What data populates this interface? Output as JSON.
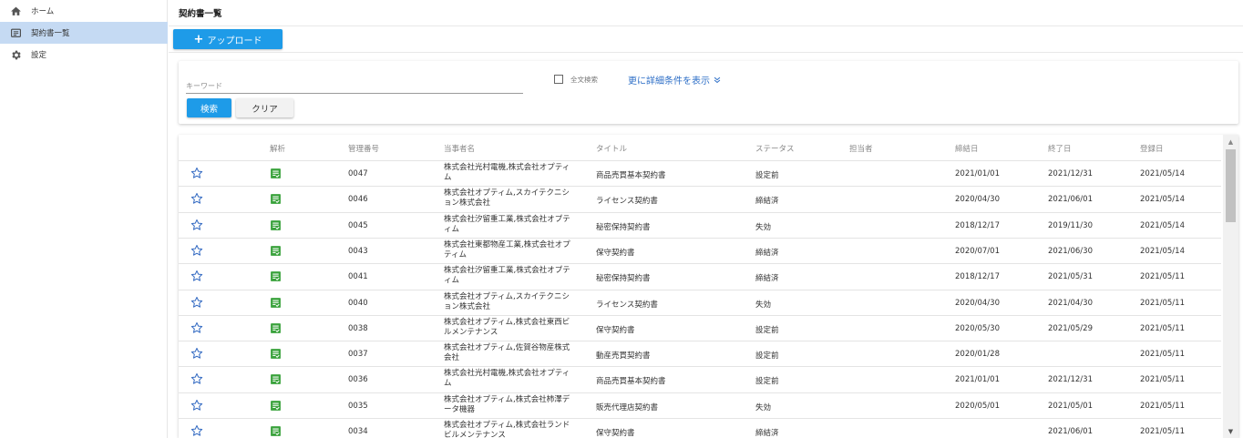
{
  "sidebar": {
    "items": [
      {
        "label": "ホーム",
        "icon": "home-icon"
      },
      {
        "label": "契約書一覧",
        "icon": "list-icon"
      },
      {
        "label": "設定",
        "icon": "gear-icon"
      }
    ]
  },
  "header": {
    "title": "契約書一覧"
  },
  "toolbar": {
    "upload_label": "アップロード",
    "upload_plus": "+"
  },
  "search": {
    "keyword_placeholder": "キーワード",
    "keyword_value": "",
    "fulltext_label": "全文検索",
    "more_conditions_label": "更に詳細条件を表示",
    "search_button": "検索",
    "clear_button": "クリア"
  },
  "table": {
    "columns": [
      "解析",
      "管理番号",
      "当事者名",
      "タイトル",
      "ステータス",
      "担当者",
      "締結日",
      "終了日",
      "登録日"
    ],
    "rows": [
      {
        "no": "0047",
        "party": "株式会社光村電機,株式会社オプティム",
        "title": "商品売買基本契約書",
        "status": "設定前",
        "owner": "",
        "signed": "2021/01/01",
        "end": "2021/12/31",
        "registered": "2021/05/14"
      },
      {
        "no": "0046",
        "party": "株式会社オプティム,スカイテクニション株式会社",
        "title": "ライセンス契約書",
        "status": "締結済",
        "owner": "",
        "signed": "2020/04/30",
        "end": "2021/06/01",
        "registered": "2021/05/14"
      },
      {
        "no": "0045",
        "party": "株式会社汐留重工業,株式会社オプティム",
        "title": "秘密保持契約書",
        "status": "失効",
        "owner": "",
        "signed": "2018/12/17",
        "end": "2019/11/30",
        "registered": "2021/05/14"
      },
      {
        "no": "0043",
        "party": "株式会社東都物産工業,株式会社オプティム",
        "title": "保守契約書",
        "status": "締結済",
        "owner": "",
        "signed": "2020/07/01",
        "end": "2021/06/30",
        "registered": "2021/05/14"
      },
      {
        "no": "0041",
        "party": "株式会社汐留重工業,株式会社オプティム",
        "title": "秘密保持契約書",
        "status": "締結済",
        "owner": "",
        "signed": "2018/12/17",
        "end": "2021/05/31",
        "registered": "2021/05/11"
      },
      {
        "no": "0040",
        "party": "株式会社オプティム,スカイテクニション株式会社",
        "title": "ライセンス契約書",
        "status": "失効",
        "owner": "",
        "signed": "2020/04/30",
        "end": "2021/04/30",
        "registered": "2021/05/11"
      },
      {
        "no": "0038",
        "party": "株式会社オプティム,株式会社東西ビルメンテナンス",
        "title": "保守契約書",
        "status": "設定前",
        "owner": "",
        "signed": "2020/05/30",
        "end": "2021/05/29",
        "registered": "2021/05/11"
      },
      {
        "no": "0037",
        "party": "株式会社オプティム,佐賀谷物産株式会社",
        "title": "動産売買契約書",
        "status": "設定前",
        "owner": "",
        "signed": "2020/01/28",
        "end": "",
        "registered": "2021/05/11"
      },
      {
        "no": "0036",
        "party": "株式会社光村電機,株式会社オプティム",
        "title": "商品売買基本契約書",
        "status": "設定前",
        "owner": "",
        "signed": "2021/01/01",
        "end": "2021/12/31",
        "registered": "2021/05/11"
      },
      {
        "no": "0035",
        "party": "株式会社オプティム,株式会社柿澤データ機器",
        "title": "販売代理店契約書",
        "status": "失効",
        "owner": "",
        "signed": "2020/05/01",
        "end": "2021/05/01",
        "registered": "2021/05/11"
      },
      {
        "no": "0034",
        "party": "株式会社オプティム,株式会社ランドビルメンテナンス",
        "title": "保守契約書",
        "status": "締結済",
        "owner": "",
        "signed": "",
        "end": "2021/06/01",
        "registered": "2021/05/11"
      }
    ]
  },
  "colors": {
    "primary": "#1e9be8",
    "nav_active": "#c5daf3",
    "link": "#2e6fc7",
    "star": "#3a6fc4",
    "analysis_icon": "#3aa23c"
  }
}
